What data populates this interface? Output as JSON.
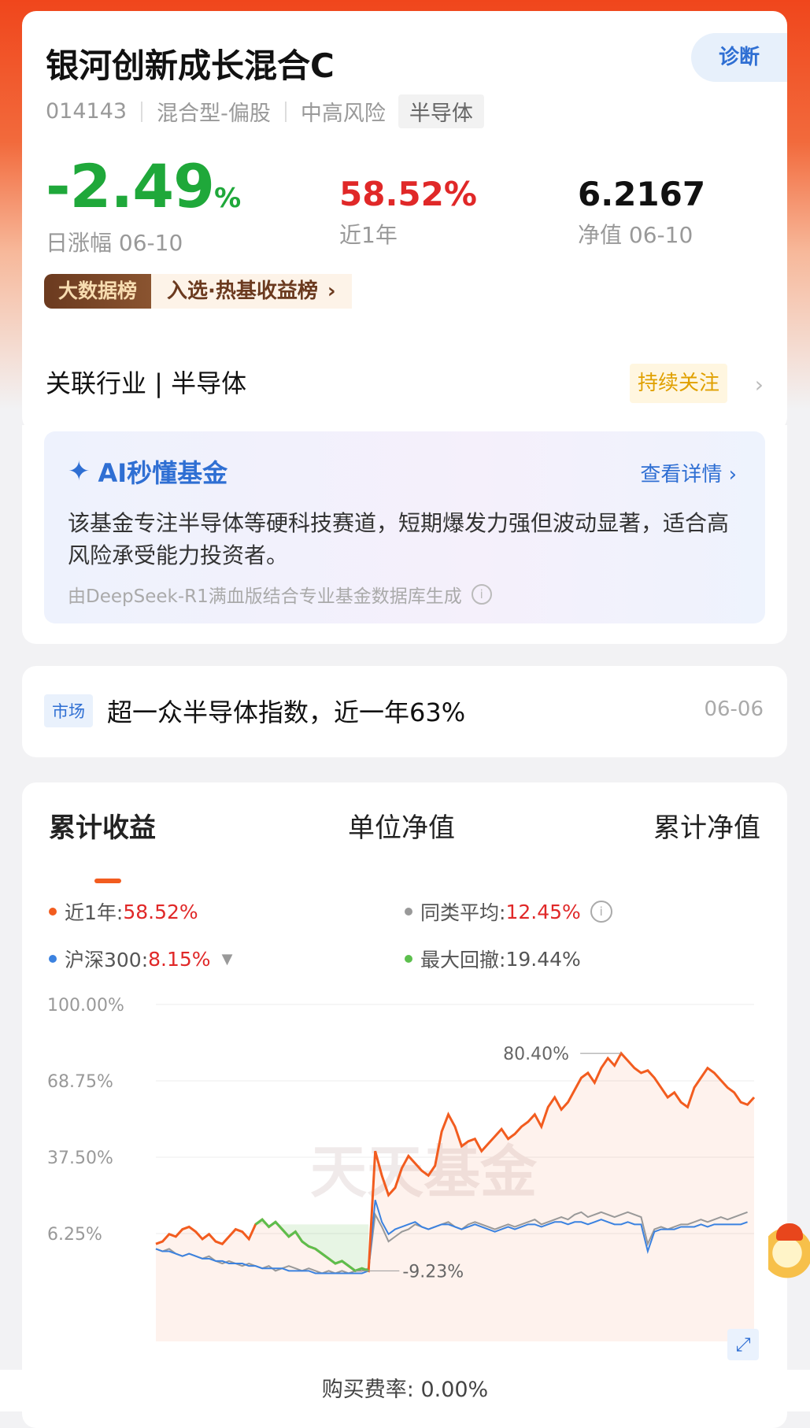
{
  "fund": {
    "name": "银河创新成长混合C",
    "diagnose_label": "诊断",
    "code": "014143",
    "type": "混合型-偏股",
    "risk": "中高风险",
    "sector_tag": "半导体"
  },
  "stats": {
    "day_change": "-2.49",
    "day_change_unit": "%",
    "day_label": "日涨幅 06-10",
    "year_return": "58.52%",
    "year_label": "近1年",
    "nav": "6.2167",
    "nav_label": "净值 06-10"
  },
  "rank": {
    "badge": "大数据榜",
    "text": "入选·热基收益榜",
    "chevron": "›"
  },
  "industry": {
    "label": "关联行业 | 半导体",
    "follow_label": "持续关注"
  },
  "ai": {
    "title": "AI秒懂基金",
    "more": "查看详情 ›",
    "summary": "该基金专注半导体等硬科技赛道，短期爆发力强但波动显著，适合高风险承受能力投资者。",
    "source": "由DeepSeek-R1满血版结合专业基金数据库生成"
  },
  "news": {
    "tag": "市场",
    "title": "超一众半导体指数，近一年63%",
    "date": "06-06"
  },
  "tabs": [
    "累计收益",
    "单位净值",
    "累计净值"
  ],
  "legend": {
    "fund_label": "近1年:",
    "fund_value": "58.52%",
    "peer_label": "同类平均:",
    "peer_value": "12.45%",
    "index_label": "沪深300:",
    "index_value": "8.15%",
    "drawdown_label": "最大回撤:",
    "drawdown_value": "19.44%"
  },
  "colors": {
    "fund": "#f25c1f",
    "peer": "#999999",
    "index": "#3b82e0",
    "drawdown": "#5cbf4d"
  },
  "chart_data": {
    "type": "line",
    "y_ticks": [
      "100.00%",
      "68.75%",
      "37.50%",
      "6.25%"
    ],
    "ylim": [
      -25,
      100
    ],
    "annotations": {
      "max": "80.40%",
      "min": "-9.23%"
    },
    "watermark": "天天基金",
    "series": [
      {
        "name": "近1年",
        "values": [
          2,
          3,
          6,
          5,
          8,
          9,
          7,
          4,
          6,
          3,
          2,
          5,
          8,
          7,
          4,
          10,
          12,
          9,
          11,
          8,
          5,
          7,
          3,
          1,
          0,
          -2,
          -4,
          -6,
          -5,
          -7,
          -9,
          -8,
          -9,
          40,
          30,
          22,
          25,
          33,
          38,
          35,
          32,
          30,
          34,
          48,
          55,
          50,
          42,
          44,
          45,
          40,
          43,
          46,
          49,
          45,
          47,
          50,
          52,
          55,
          50,
          58,
          62,
          57,
          60,
          65,
          70,
          72,
          68,
          74,
          78,
          75,
          80,
          77,
          74,
          72,
          73,
          70,
          66,
          62,
          64,
          60,
          58,
          66,
          70,
          74,
          72,
          69,
          66,
          64,
          60,
          59,
          62
        ],
        "drawdown_range": [
          15,
          32
        ]
      },
      {
        "name": "同类平均",
        "values": [
          0,
          -1,
          0,
          -2,
          -3,
          -2,
          -3,
          -4,
          -3,
          -5,
          -6,
          -5,
          -6,
          -7,
          -6,
          -7,
          -8,
          -7,
          -9,
          -8,
          -7,
          -8,
          -9,
          -8,
          -9,
          -10,
          -9,
          -10,
          -9,
          -10,
          -9,
          -9,
          -8,
          14,
          9,
          3,
          5,
          7,
          8,
          10,
          9,
          8,
          9,
          10,
          11,
          9,
          8,
          10,
          11,
          10,
          9,
          8,
          9,
          10,
          9,
          10,
          11,
          12,
          10,
          11,
          12,
          13,
          12,
          14,
          15,
          13,
          14,
          15,
          14,
          13,
          14,
          15,
          14,
          13,
          2,
          8,
          9,
          8,
          9,
          10,
          10,
          11,
          12,
          11,
          12,
          13,
          12,
          13,
          14,
          15
        ]
      },
      {
        "name": "沪深300",
        "values": [
          0,
          -1,
          -1,
          -2,
          -3,
          -2,
          -3,
          -4,
          -4,
          -5,
          -5,
          -6,
          -6,
          -6,
          -7,
          -7,
          -8,
          -8,
          -8,
          -8,
          -9,
          -9,
          -9,
          -9,
          -10,
          -10,
          -10,
          -10,
          -10,
          -10,
          -10,
          -10,
          -9,
          20,
          11,
          6,
          8,
          9,
          10,
          11,
          9,
          8,
          9,
          10,
          10,
          9,
          8,
          9,
          10,
          9,
          8,
          7,
          8,
          9,
          8,
          9,
          10,
          10,
          9,
          10,
          11,
          11,
          10,
          11,
          11,
          10,
          11,
          12,
          11,
          10,
          10,
          11,
          10,
          10,
          -1,
          7,
          8,
          8,
          8,
          9,
          9,
          9,
          10,
          9,
          10,
          10,
          10,
          10,
          10,
          11
        ]
      }
    ]
  },
  "footer": {
    "fee": "购买费率: 0.00%"
  }
}
